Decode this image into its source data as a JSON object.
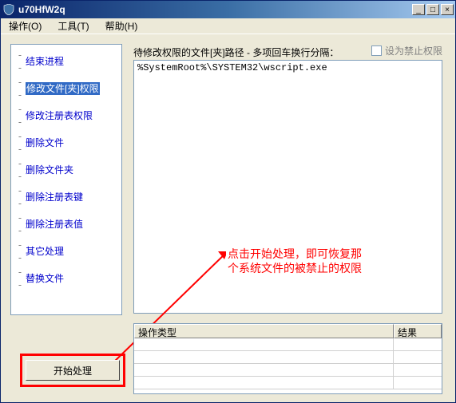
{
  "window": {
    "title": "u70HfW2q"
  },
  "menu": {
    "operate": "操作(O)",
    "tools": "工具(T)",
    "help": "帮助(H)"
  },
  "tree": {
    "items": [
      {
        "label": "结束进程"
      },
      {
        "label": "修改文件[夹]权限",
        "selected": true
      },
      {
        "label": "修改注册表权限"
      },
      {
        "label": "删除文件"
      },
      {
        "label": "删除文件夹"
      },
      {
        "label": "删除注册表键"
      },
      {
        "label": "删除注册表值"
      },
      {
        "label": "其它处理"
      },
      {
        "label": "替换文件"
      }
    ]
  },
  "top_label": "待修改权限的文件[夹]路径 - 多项回车换行分隔：",
  "checkbox_label": "设为禁止权限",
  "textarea_value": "%SystemRoot%\\SYSTEM32\\wscript.exe",
  "annotation": "点击开始处理，即可恢复那个系统文件的被禁止的权限",
  "table": {
    "col1": "操作类型",
    "col2": "结果"
  },
  "start_button": "开始处理",
  "win_btn": {
    "min": "_",
    "max": "□",
    "close": "×"
  }
}
